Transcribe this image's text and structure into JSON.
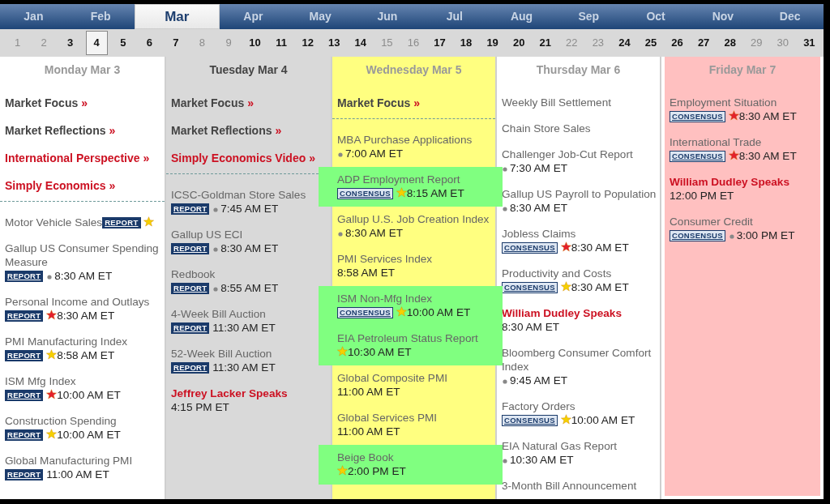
{
  "months": [
    {
      "label": "Jan",
      "selected": false
    },
    {
      "label": "Feb",
      "selected": false
    },
    {
      "label": "Mar",
      "selected": true
    },
    {
      "label": "Apr",
      "selected": false
    },
    {
      "label": "May",
      "selected": false
    },
    {
      "label": "Jun",
      "selected": false
    },
    {
      "label": "Jul",
      "selected": false
    },
    {
      "label": "Aug",
      "selected": false
    },
    {
      "label": "Sep",
      "selected": false
    },
    {
      "label": "Oct",
      "selected": false
    },
    {
      "label": "Nov",
      "selected": false
    },
    {
      "label": "Dec",
      "selected": false
    }
  ],
  "days": [
    {
      "label": "1",
      "enabled": false,
      "selected": false
    },
    {
      "label": "2",
      "enabled": false,
      "selected": false
    },
    {
      "label": "3",
      "enabled": true,
      "selected": false
    },
    {
      "label": "4",
      "enabled": true,
      "selected": true
    },
    {
      "label": "5",
      "enabled": true,
      "selected": false
    },
    {
      "label": "6",
      "enabled": true,
      "selected": false
    },
    {
      "label": "7",
      "enabled": true,
      "selected": false
    },
    {
      "label": "8",
      "enabled": false,
      "selected": false
    },
    {
      "label": "9",
      "enabled": false,
      "selected": false
    },
    {
      "label": "10",
      "enabled": true,
      "selected": false
    },
    {
      "label": "11",
      "enabled": true,
      "selected": false
    },
    {
      "label": "12",
      "enabled": true,
      "selected": false
    },
    {
      "label": "13",
      "enabled": true,
      "selected": false
    },
    {
      "label": "14",
      "enabled": true,
      "selected": false
    },
    {
      "label": "15",
      "enabled": false,
      "selected": false
    },
    {
      "label": "16",
      "enabled": false,
      "selected": false
    },
    {
      "label": "17",
      "enabled": true,
      "selected": false
    },
    {
      "label": "18",
      "enabled": true,
      "selected": false
    },
    {
      "label": "19",
      "enabled": true,
      "selected": false
    },
    {
      "label": "20",
      "enabled": true,
      "selected": false
    },
    {
      "label": "21",
      "enabled": true,
      "selected": false
    },
    {
      "label": "22",
      "enabled": false,
      "selected": false
    },
    {
      "label": "23",
      "enabled": false,
      "selected": false
    },
    {
      "label": "24",
      "enabled": true,
      "selected": false
    },
    {
      "label": "25",
      "enabled": true,
      "selected": false
    },
    {
      "label": "26",
      "enabled": true,
      "selected": false
    },
    {
      "label": "27",
      "enabled": true,
      "selected": false
    },
    {
      "label": "28",
      "enabled": true,
      "selected": false
    },
    {
      "label": "29",
      "enabled": false,
      "selected": false
    },
    {
      "label": "30",
      "enabled": false,
      "selected": false
    },
    {
      "label": "31",
      "enabled": true,
      "selected": false
    }
  ],
  "columns": [
    {
      "title": "Monday Mar 3",
      "selected": false,
      "color": "#ffffff",
      "items": [
        {
          "kind": "link",
          "label": "Market Focus",
          "arrow": "»",
          "highlight": false
        },
        {
          "kind": "link",
          "label": "Market Reflections",
          "arrow": "»",
          "highlight": false
        },
        {
          "kind": "link",
          "label": "International Perspective",
          "arrow": "»",
          "highlight": true
        },
        {
          "kind": "link",
          "label": "Simply Economics",
          "arrow": "»",
          "highlight": true
        },
        {
          "kind": "divider"
        },
        {
          "kind": "event",
          "name": "Motor Vehicle Sales",
          "badge": {
            "kind": "report",
            "label": "REPORT"
          },
          "marker": {
            "kind": "star",
            "color": "#f5d000"
          },
          "highlight": false,
          "speaker": false
        },
        {
          "kind": "event",
          "name": "Gallup US Consumer Spending Measure",
          "badge": {
            "kind": "report",
            "label": "REPORT"
          },
          "marker": {
            "kind": "dot"
          },
          "time": "8:30 AM ET",
          "highlight": false,
          "speaker": false
        },
        {
          "kind": "event",
          "name": "Personal Income and Outlays",
          "badge": {
            "kind": "report",
            "label": "REPORT"
          },
          "marker": {
            "kind": "star",
            "color": "#e3202c"
          },
          "time": "8:30 AM ET",
          "highlight": false,
          "speaker": false
        },
        {
          "kind": "event",
          "name": "PMI Manufacturing Index",
          "badge": {
            "kind": "report",
            "label": "REPORT"
          },
          "marker": {
            "kind": "star",
            "color": "#f5d000"
          },
          "time": "8:58 AM ET",
          "highlight": false,
          "speaker": false
        },
        {
          "kind": "event",
          "name": "ISM Mfg Index",
          "badge": {
            "kind": "report",
            "label": "REPORT"
          },
          "marker": {
            "kind": "star",
            "color": "#e3202c"
          },
          "time": "10:00 AM ET",
          "highlight": false,
          "speaker": false
        },
        {
          "kind": "event",
          "name": "Construction Spending",
          "badge": {
            "kind": "report",
            "label": "REPORT"
          },
          "marker": {
            "kind": "star",
            "color": "#f5d000"
          },
          "time": "10:00 AM ET",
          "highlight": false,
          "speaker": false
        },
        {
          "kind": "event",
          "name": "Global Manufacturing PMI",
          "badge": {
            "kind": "report",
            "label": "REPORT"
          },
          "time": "11:00 AM ET",
          "highlight": false,
          "speaker": false
        }
      ]
    },
    {
      "title": "Tuesday Mar 4",
      "selected": true,
      "color": "#d9d9d9",
      "items": [
        {
          "kind": "link",
          "label": "Market Focus",
          "arrow": "»",
          "highlight": false
        },
        {
          "kind": "link",
          "label": "Market Reflections",
          "arrow": "»",
          "highlight": false
        },
        {
          "kind": "link",
          "label": "Simply Economics Video",
          "arrow": "»",
          "highlight": true
        },
        {
          "kind": "divider"
        },
        {
          "kind": "event",
          "name": "ICSC-Goldman Store Sales",
          "badge": {
            "kind": "report",
            "label": "REPORT"
          },
          "marker": {
            "kind": "dot"
          },
          "time": "7:45 AM ET",
          "highlight": false,
          "speaker": false
        },
        {
          "kind": "event",
          "name": "Gallup US ECI",
          "badge": {
            "kind": "report",
            "label": "REPORT"
          },
          "marker": {
            "kind": "dot"
          },
          "time": "8:30 AM ET",
          "highlight": false,
          "speaker": false
        },
        {
          "kind": "event",
          "name": "Redbook",
          "badge": {
            "kind": "report",
            "label": "REPORT"
          },
          "marker": {
            "kind": "dot"
          },
          "time": "8:55 AM ET",
          "highlight": false,
          "speaker": false
        },
        {
          "kind": "event",
          "name": "4-Week Bill Auction",
          "badge": {
            "kind": "report",
            "label": "REPORT"
          },
          "time": "11:30 AM ET",
          "highlight": false,
          "speaker": false
        },
        {
          "kind": "event",
          "name": "52-Week Bill Auction",
          "badge": {
            "kind": "report",
            "label": "REPORT"
          },
          "time": "11:30 AM ET",
          "highlight": false,
          "speaker": false
        },
        {
          "kind": "event",
          "name": "Jeffrey Lacker Speaks",
          "time": "4:15 PM ET",
          "highlight": false,
          "speaker": true
        }
      ]
    },
    {
      "title": "Wednesday Mar 5",
      "selected": false,
      "color": "#ffff80",
      "items": [
        {
          "kind": "link",
          "label": "Market Focus",
          "arrow": "»",
          "highlight": false
        },
        {
          "kind": "divider"
        },
        {
          "kind": "event",
          "name": "MBA Purchase Applications",
          "marker": {
            "kind": "dot"
          },
          "time": "7:00 AM ET",
          "highlight": false,
          "speaker": false
        },
        {
          "kind": "event",
          "name": "ADP Employment Report",
          "badge": {
            "kind": "consensus",
            "label": "CONSENSUS"
          },
          "marker": {
            "kind": "star",
            "color": "#f5d000"
          },
          "time": "8:15 AM ET",
          "highlight": true,
          "speaker": false
        },
        {
          "kind": "event",
          "name": "Gallup U.S. Job Creation Index",
          "marker": {
            "kind": "dot"
          },
          "time": "8:30 AM ET",
          "highlight": false,
          "speaker": false
        },
        {
          "kind": "event",
          "name": "PMI Services Index",
          "time": "8:58 AM ET",
          "highlight": false,
          "speaker": false
        },
        {
          "kind": "event",
          "name": "ISM Non-Mfg Index",
          "badge": {
            "kind": "consensus",
            "label": "CONSENSUS"
          },
          "marker": {
            "kind": "star",
            "color": "#f5d000"
          },
          "time": "10:00 AM ET",
          "highlight": true,
          "speaker": false
        },
        {
          "kind": "event",
          "name": "EIA Petroleum Status Report",
          "marker": {
            "kind": "star",
            "color": "#f5d000"
          },
          "time": "10:30 AM ET",
          "highlight": true,
          "speaker": false
        },
        {
          "kind": "event",
          "name": "Global Composite PMI",
          "time": "11:00 AM ET",
          "highlight": false,
          "speaker": false
        },
        {
          "kind": "event",
          "name": "Global Services PMI",
          "time": "11:00 AM ET",
          "highlight": false,
          "speaker": false
        },
        {
          "kind": "event",
          "name": "Beige Book",
          "marker": {
            "kind": "star",
            "color": "#f5d000"
          },
          "time": "2:00 PM ET",
          "highlight": true,
          "speaker": false
        }
      ]
    },
    {
      "title": "Thursday Mar 6",
      "selected": false,
      "color": "#ffffff",
      "items": [
        {
          "kind": "event",
          "name": "Weekly Bill Settlement",
          "highlight": false,
          "speaker": false
        },
        {
          "kind": "event",
          "name": "Chain Store Sales",
          "highlight": false,
          "speaker": false
        },
        {
          "kind": "event",
          "name": "Challenger Job-Cut Report",
          "marker": {
            "kind": "dot"
          },
          "time": "7:30 AM ET",
          "highlight": false,
          "speaker": false
        },
        {
          "kind": "event",
          "name": "Gallup US Payroll to Population",
          "marker": {
            "kind": "dot"
          },
          "time": "8:30 AM ET",
          "highlight": false,
          "speaker": false
        },
        {
          "kind": "event",
          "name": "Jobless Claims",
          "badge": {
            "kind": "consensus",
            "label": "CONSENSUS"
          },
          "marker": {
            "kind": "star",
            "color": "#e3202c"
          },
          "time": "8:30 AM ET",
          "highlight": false,
          "speaker": false
        },
        {
          "kind": "event",
          "name": "Productivity and Costs",
          "badge": {
            "kind": "consensus",
            "label": "CONSENSUS"
          },
          "marker": {
            "kind": "star",
            "color": "#f5d000"
          },
          "time": "8:30 AM ET",
          "highlight": false,
          "speaker": false
        },
        {
          "kind": "event",
          "name": "William Dudley Speaks",
          "time": "8:30 AM ET",
          "highlight": false,
          "speaker": true
        },
        {
          "kind": "event",
          "name": "Bloomberg Consumer Comfort Index",
          "marker": {
            "kind": "dot"
          },
          "time": "9:45 AM ET",
          "highlight": false,
          "speaker": false
        },
        {
          "kind": "event",
          "name": "Factory Orders",
          "badge": {
            "kind": "consensus",
            "label": "CONSENSUS"
          },
          "marker": {
            "kind": "star",
            "color": "#f5d000"
          },
          "time": "10:00 AM ET",
          "highlight": false,
          "speaker": false
        },
        {
          "kind": "event",
          "name": "EIA Natural Gas Report",
          "marker": {
            "kind": "dot"
          },
          "time": "10:30 AM ET",
          "highlight": false,
          "speaker": false
        },
        {
          "kind": "event",
          "name": "3-Month Bill Announcement",
          "highlight": false,
          "speaker": false
        }
      ]
    },
    {
      "title": "Friday Mar 7",
      "selected": false,
      "color": "#ffc0c0",
      "items": [
        {
          "kind": "event",
          "name": "Employment Situation",
          "badge": {
            "kind": "consensus",
            "label": "CONSENSUS"
          },
          "marker": {
            "kind": "star",
            "color": "#e3202c"
          },
          "time": "8:30 AM ET",
          "highlight": false,
          "speaker": false
        },
        {
          "kind": "event",
          "name": "International Trade",
          "badge": {
            "kind": "consensus",
            "label": "CONSENSUS"
          },
          "marker": {
            "kind": "star",
            "color": "#e3202c"
          },
          "time": "8:30 AM ET",
          "highlight": false,
          "speaker": false
        },
        {
          "kind": "event",
          "name": "William Dudley Speaks",
          "time": "12:00 PM ET",
          "highlight": false,
          "speaker": true
        },
        {
          "kind": "event",
          "name": "Consumer Credit",
          "badge": {
            "kind": "consensus",
            "label": "CONSENSUS"
          },
          "marker": {
            "kind": "dot"
          },
          "time": "3:00 PM ET",
          "highlight": false,
          "speaker": false
        }
      ]
    }
  ]
}
